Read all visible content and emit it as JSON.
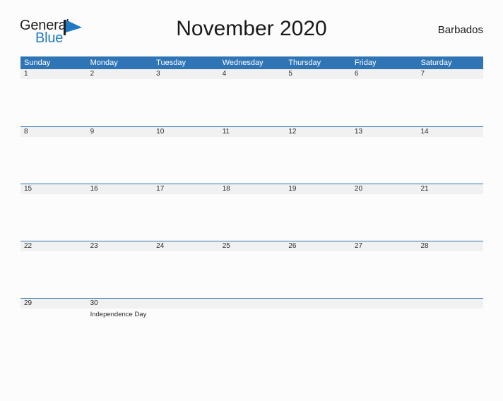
{
  "brand": {
    "name_part1": "General",
    "name_part2": "Blue",
    "flag_icon": "blue-flag-triangle-icon",
    "color_primary": "#1f7ac4",
    "color_text": "#231f20"
  },
  "header": {
    "title": "November 2020",
    "region": "Barbados"
  },
  "calendar": {
    "header_background": "#2f74b5",
    "daynum_band_background": "#f1f1f1",
    "week_divider_color": "#2f74b5",
    "weekdays": [
      "Sunday",
      "Monday",
      "Tuesday",
      "Wednesday",
      "Thursday",
      "Friday",
      "Saturday"
    ],
    "weeks": [
      [
        {
          "day": "1",
          "events": []
        },
        {
          "day": "2",
          "events": []
        },
        {
          "day": "3",
          "events": []
        },
        {
          "day": "4",
          "events": []
        },
        {
          "day": "5",
          "events": []
        },
        {
          "day": "6",
          "events": []
        },
        {
          "day": "7",
          "events": []
        }
      ],
      [
        {
          "day": "8",
          "events": []
        },
        {
          "day": "9",
          "events": []
        },
        {
          "day": "10",
          "events": []
        },
        {
          "day": "11",
          "events": []
        },
        {
          "day": "12",
          "events": []
        },
        {
          "day": "13",
          "events": []
        },
        {
          "day": "14",
          "events": []
        }
      ],
      [
        {
          "day": "15",
          "events": []
        },
        {
          "day": "16",
          "events": []
        },
        {
          "day": "17",
          "events": []
        },
        {
          "day": "18",
          "events": []
        },
        {
          "day": "19",
          "events": []
        },
        {
          "day": "20",
          "events": []
        },
        {
          "day": "21",
          "events": []
        }
      ],
      [
        {
          "day": "22",
          "events": []
        },
        {
          "day": "23",
          "events": []
        },
        {
          "day": "24",
          "events": []
        },
        {
          "day": "25",
          "events": []
        },
        {
          "day": "26",
          "events": []
        },
        {
          "day": "27",
          "events": []
        },
        {
          "day": "28",
          "events": []
        }
      ],
      [
        {
          "day": "29",
          "events": []
        },
        {
          "day": "30",
          "events": [
            "Independence Day"
          ]
        },
        {
          "day": "",
          "events": []
        },
        {
          "day": "",
          "events": []
        },
        {
          "day": "",
          "events": []
        },
        {
          "day": "",
          "events": []
        },
        {
          "day": "",
          "events": []
        }
      ]
    ]
  }
}
